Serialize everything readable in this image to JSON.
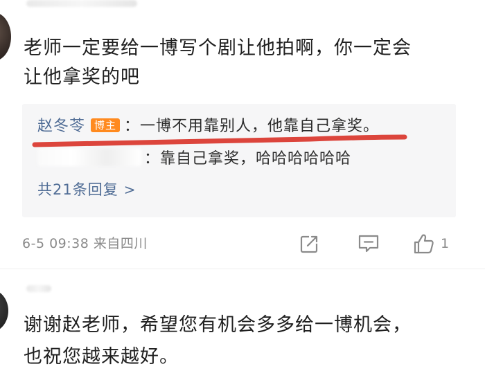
{
  "comment1": {
    "text_line1": "老师一定要给一博写个剧让他拍啊，你一定会",
    "text_line2": "让他拿奖的吧"
  },
  "reply_box": {
    "reply1": {
      "author": "赵冬苓",
      "badge": "博主",
      "text": "：一博不用靠别人，他靠自己拿奖。"
    },
    "reply2": {
      "text": "：靠自己拿奖，哈哈哈哈哈哈"
    },
    "more_replies_label": "共21条回复",
    "more_replies_chevron": ">"
  },
  "meta": {
    "timestamp_location": "6-5 09:38  来自四川"
  },
  "actions": {
    "like_count": "1",
    "share_icon": "share-icon",
    "comment_icon": "comment-icon",
    "like_icon": "thumbs-up-icon"
  },
  "comment2": {
    "text_line1": "谢谢赵老师，希望您有机会多多给一博机会，",
    "text_line2": "也祝您越来越好。"
  },
  "colors": {
    "link": "#4f6c95",
    "badge": "#ff8a1f",
    "underline": "#d9352b",
    "reply_bg": "#f6f6f7",
    "meta": "#8a8a8a"
  }
}
